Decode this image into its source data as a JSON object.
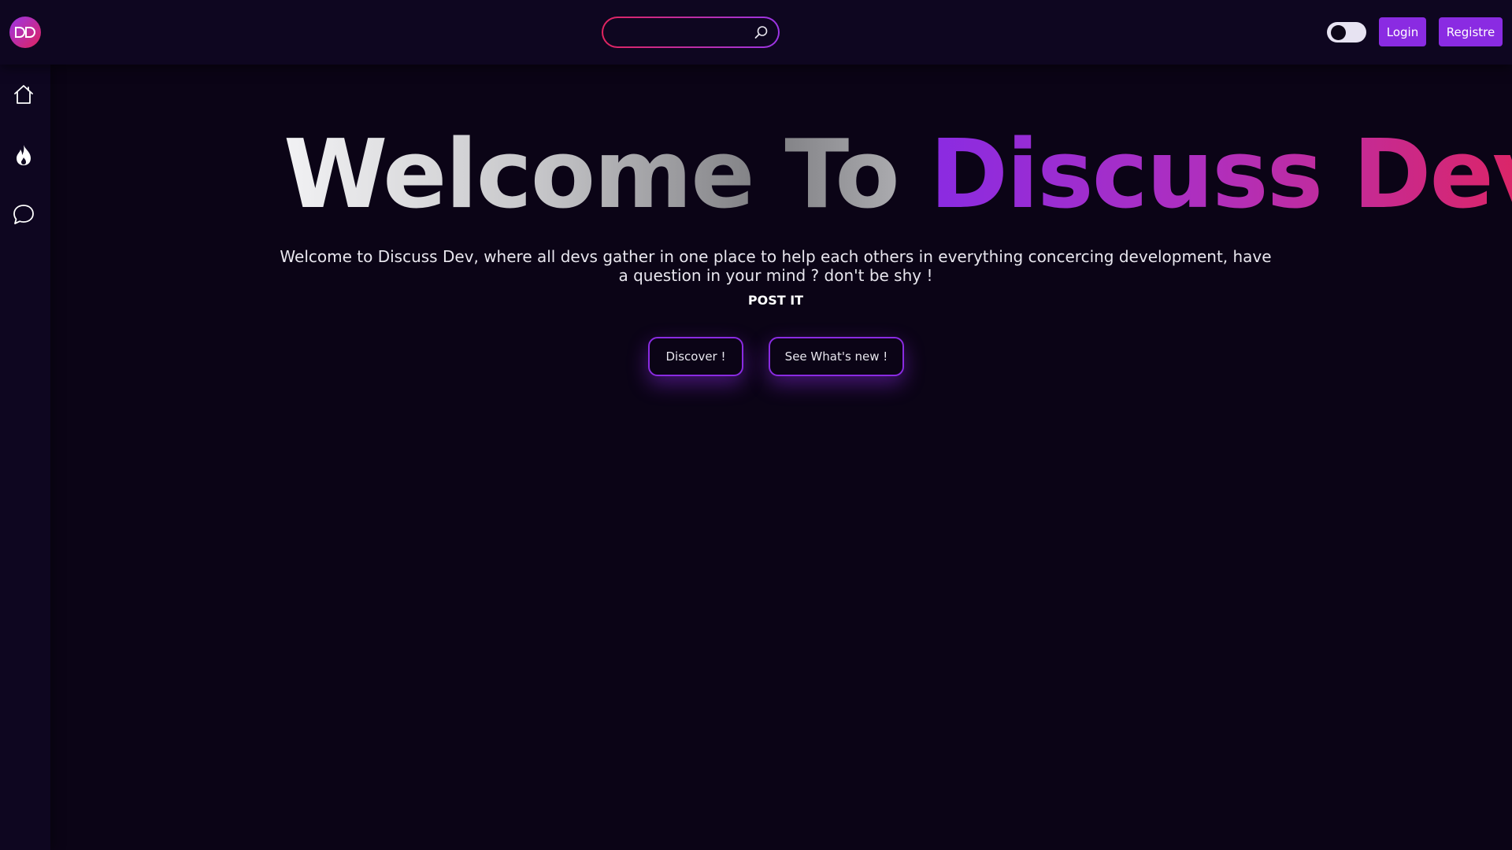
{
  "header": {
    "search": {
      "placeholder": "",
      "value": ""
    },
    "theme_toggle": {
      "state": "dark"
    },
    "login_label": "Login",
    "register_label": "Registre"
  },
  "sidebar": {
    "items": [
      {
        "id": "home",
        "icon": "home-icon"
      },
      {
        "id": "trending",
        "icon": "fire-icon"
      },
      {
        "id": "discussions",
        "icon": "chat-bubble-icon"
      }
    ]
  },
  "hero": {
    "title_part1": "Welcome To ",
    "title_part2": "Discuss Dev",
    "description": "Welcome to Discuss Dev, where all devs gather in one place to help each others in everything concercing development, have a question in your mind ? don't be shy !",
    "cta": "POST IT",
    "discover_label": "Discover !",
    "whats_new_label": "See What's new !"
  },
  "colors": {
    "background": "#0b0416",
    "accent_purple": "#8a2be2",
    "accent_pink": "#e0245e"
  }
}
